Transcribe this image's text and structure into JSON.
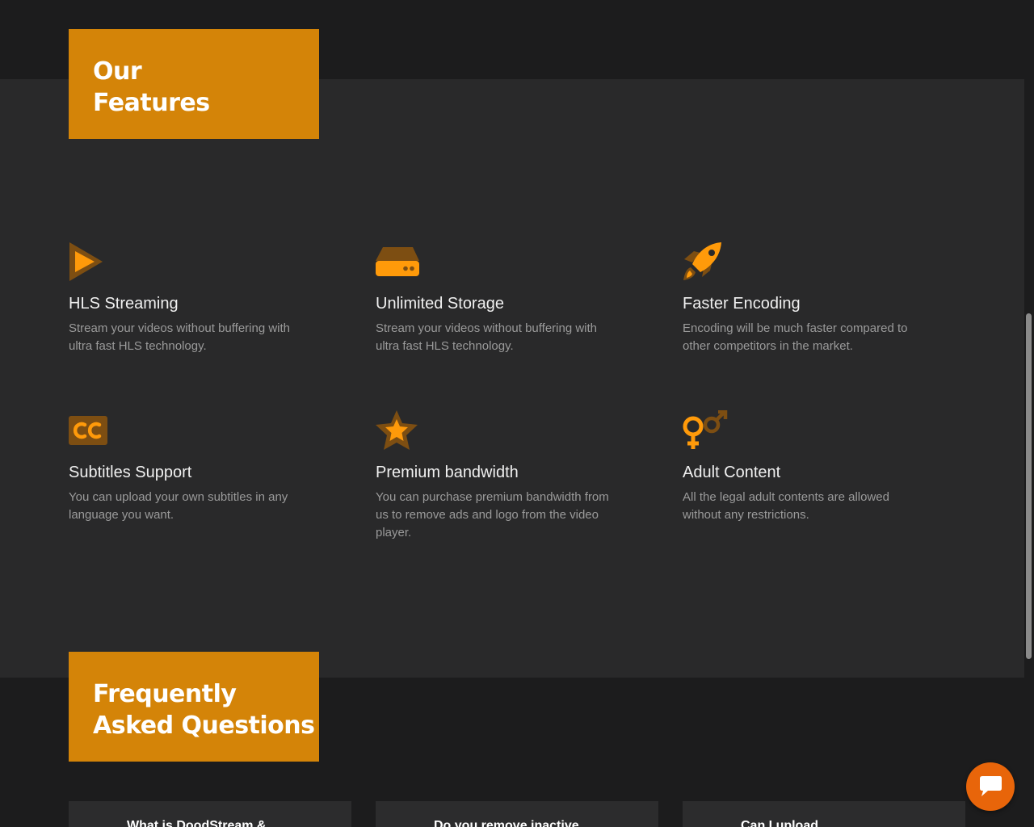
{
  "features_section": {
    "title_line1": "Our",
    "title_line2": "Features",
    "items": [
      {
        "icon": "play-icon",
        "title": "HLS Streaming",
        "description": "Stream your videos without buffering with ultra fast HLS technology."
      },
      {
        "icon": "hard-drive-icon",
        "title": "Unlimited Storage",
        "description": "Stream your videos without buffering with ultra fast HLS technology."
      },
      {
        "icon": "rocket-icon",
        "title": "Faster Encoding",
        "description": "Encoding will be much faster compared to other competitors in the market."
      },
      {
        "icon": "closed-captions-icon",
        "title": "Subtitles Support",
        "description": "You can upload your own subtitles in any language you want."
      },
      {
        "icon": "star-icon",
        "title": "Premium bandwidth",
        "description": "You can purchase premium bandwidth from us to remove ads and logo from the video player."
      },
      {
        "icon": "venus-mars-icon",
        "title": "Adult Content",
        "description": "All the legal adult contents are allowed without any restrictions."
      }
    ]
  },
  "faq_section": {
    "title_line1": "Frequently",
    "title_line2": "Asked Questions",
    "questions": [
      {
        "text": "What is DoodStream &"
      },
      {
        "text": "Do you remove inactive"
      },
      {
        "text": "Can I upload"
      }
    ]
  },
  "chat_widget": {
    "icon": "chat-icon"
  },
  "colors": {
    "accent": "#d48408",
    "icon_primary": "#ff9a0a",
    "icon_secondary": "#7d4e12",
    "chat": "#e8650a"
  }
}
